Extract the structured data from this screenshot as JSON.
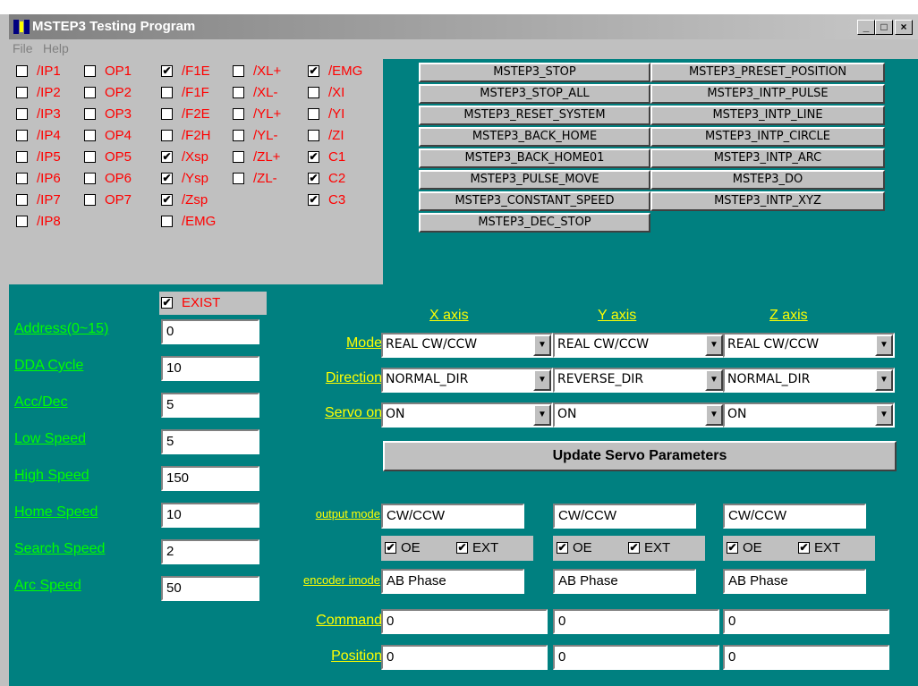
{
  "window": {
    "title": "MSTEP3 Testing Program",
    "min": "_",
    "max": "□",
    "close": "×"
  },
  "menu": {
    "file": "File",
    "help": "Help"
  },
  "check_mark": "✔",
  "checks": {
    "col1": [
      {
        "label": "/IP1",
        "checked": false
      },
      {
        "label": "/IP2",
        "checked": false
      },
      {
        "label": "/IP3",
        "checked": false
      },
      {
        "label": "/IP4",
        "checked": false
      },
      {
        "label": "/IP5",
        "checked": false
      },
      {
        "label": "/IP6",
        "checked": false
      },
      {
        "label": "/IP7",
        "checked": false
      },
      {
        "label": "/IP8",
        "checked": false
      }
    ],
    "col2": [
      {
        "label": "OP1",
        "checked": false
      },
      {
        "label": "OP2",
        "checked": false
      },
      {
        "label": "OP3",
        "checked": false
      },
      {
        "label": "OP4",
        "checked": false
      },
      {
        "label": "OP5",
        "checked": false
      },
      {
        "label": "OP6",
        "checked": false
      },
      {
        "label": "OP7",
        "checked": false
      }
    ],
    "col3": [
      {
        "label": "/F1E",
        "checked": true
      },
      {
        "label": "/F1F",
        "checked": false
      },
      {
        "label": "/F2E",
        "checked": false
      },
      {
        "label": "/F2H",
        "checked": false
      },
      {
        "label": "/Xsp",
        "checked": true
      },
      {
        "label": "/Ysp",
        "checked": true
      },
      {
        "label": "/Zsp",
        "checked": true
      },
      {
        "label": "/EMG",
        "checked": false
      }
    ],
    "col4": [
      {
        "label": "/XL+",
        "checked": false
      },
      {
        "label": "/XL-",
        "checked": false
      },
      {
        "label": "/YL+",
        "checked": false
      },
      {
        "label": "/YL-",
        "checked": false
      },
      {
        "label": "/ZL+",
        "checked": false
      },
      {
        "label": "/ZL-",
        "checked": false
      }
    ],
    "col5": [
      {
        "label": "/EMG",
        "checked": true
      },
      {
        "label": "/XI",
        "checked": false
      },
      {
        "label": "/YI",
        "checked": false
      },
      {
        "label": "/ZI",
        "checked": false
      },
      {
        "label": "C1",
        "checked": true
      },
      {
        "label": "C2",
        "checked": true
      },
      {
        "label": "C3",
        "checked": true
      }
    ]
  },
  "commands_left": [
    "MSTEP3_STOP",
    "MSTEP3_STOP_ALL",
    "MSTEP3_RESET_SYSTEM",
    "MSTEP3_BACK_HOME",
    "MSTEP3_BACK_HOME01",
    "MSTEP3_PULSE_MOVE",
    "MSTEP3_CONSTANT_SPEED",
    "MSTEP3_DEC_STOP"
  ],
  "commands_right": [
    "MSTEP3_PRESET_POSITION",
    "MSTEP3_INTP_PULSE",
    "MSTEP3_INTP_LINE",
    "MSTEP3_INTP_CIRCLE",
    "MSTEP3_INTP_ARC",
    "MSTEP3_DO",
    "MSTEP3_INTP_XYZ"
  ],
  "exist": {
    "label": "EXIST",
    "checked": true
  },
  "params": [
    {
      "label": "Address(0~15)",
      "value": "0"
    },
    {
      "label": "DDA Cycle",
      "value": "10"
    },
    {
      "label": "Acc/Dec",
      "value": "5"
    },
    {
      "label": "Low Speed",
      "value": "5"
    },
    {
      "label": "High Speed",
      "value": "150"
    },
    {
      "label": "Home Speed",
      "value": "10"
    },
    {
      "label": "Search Speed",
      "value": "2"
    },
    {
      "label": "Arc Speed",
      "value": "50"
    }
  ],
  "axes_header": [
    "X axis",
    "Y axis",
    "Z axis"
  ],
  "row_labels": {
    "mode": "Mode",
    "direction": "Direction",
    "servo": "Servo on",
    "output": "output mode",
    "encoder": "encoder imode",
    "command": "Command",
    "position": "Position"
  },
  "axes": [
    {
      "mode": "REAL CW/CCW",
      "direction": "NORMAL_DIR",
      "servo": "ON",
      "output": "CW/CCW",
      "oe": "OE",
      "ext": "EXT",
      "encoder": "AB Phase",
      "command": "0",
      "position": "0"
    },
    {
      "mode": "REAL CW/CCW",
      "direction": "REVERSE_DIR",
      "servo": "ON",
      "output": "CW/CCW",
      "oe": "OE",
      "ext": "EXT",
      "encoder": "AB Phase",
      "command": "0",
      "position": "0"
    },
    {
      "mode": "REAL CW/CCW",
      "direction": "NORMAL_DIR",
      "servo": "ON",
      "output": "CW/CCW",
      "oe": "OE",
      "ext": "EXT",
      "encoder": "AB Phase",
      "command": "0",
      "position": "0"
    }
  ],
  "update_button": "Update Servo Parameters",
  "dropdown_arrow": "▼"
}
